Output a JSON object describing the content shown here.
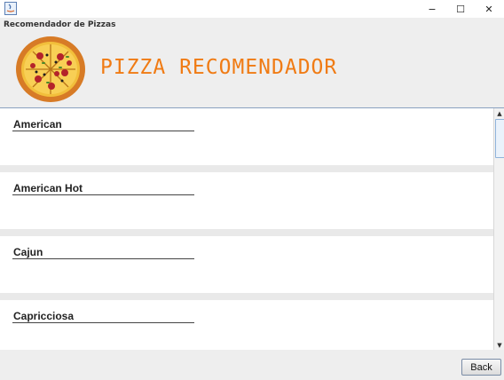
{
  "window": {
    "app_title": "Recomendador de Pizzas",
    "controls": {
      "minimize": "−",
      "maximize": "☐",
      "close": "✕"
    }
  },
  "header": {
    "brand_text": "PIZZA RECOMENDADOR",
    "brand_color": "#f07b14",
    "logo_icon": "pizza-logo"
  },
  "pizzas": [
    {
      "name": "American"
    },
    {
      "name": "American Hot"
    },
    {
      "name": "Cajun"
    },
    {
      "name": "Capricciosa"
    }
  ],
  "scrollbar": {
    "up_icon": "▲",
    "down_icon": "▼"
  },
  "footer": {
    "back_label": "Back"
  }
}
